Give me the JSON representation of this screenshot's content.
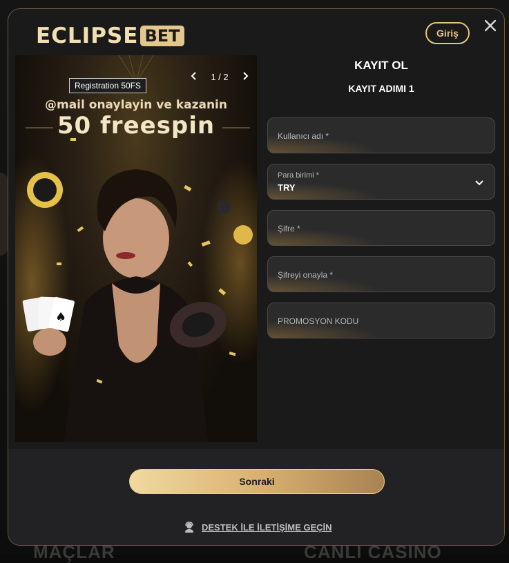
{
  "brand": {
    "logo_main": "ECLIPSE",
    "logo_suffix": "BET"
  },
  "header": {
    "login_label": "Giriş",
    "close_icon": "close-icon"
  },
  "promo": {
    "badge": "Registration 50FS",
    "pager": "1 / 2",
    "headline_line1": "@mail onaylayin ve kazanin",
    "headline_line2": "50 freespin"
  },
  "form": {
    "title": "KAYIT OL",
    "step": "KAYIT ADIMI 1",
    "fields": {
      "username": {
        "label": "Kullanıcı adı *"
      },
      "currency": {
        "label": "Para birimi *",
        "value": "TRY"
      },
      "password": {
        "label": "Şifre *"
      },
      "password_confirm": {
        "label": "Şifreyi onayla *"
      },
      "promo_code": {
        "label": "PROMOSYON KODU"
      }
    }
  },
  "footer": {
    "next_label": "Sonraki",
    "support_label": "DESTEK İLE İLETİŞİME GEÇİN"
  },
  "background": {
    "left_text": "MAÇLAR",
    "right_text": "CANLI CASINO"
  },
  "colors": {
    "gold": "#e6c582",
    "panel": "#1a1a1b",
    "field": "#2b2b2c"
  }
}
